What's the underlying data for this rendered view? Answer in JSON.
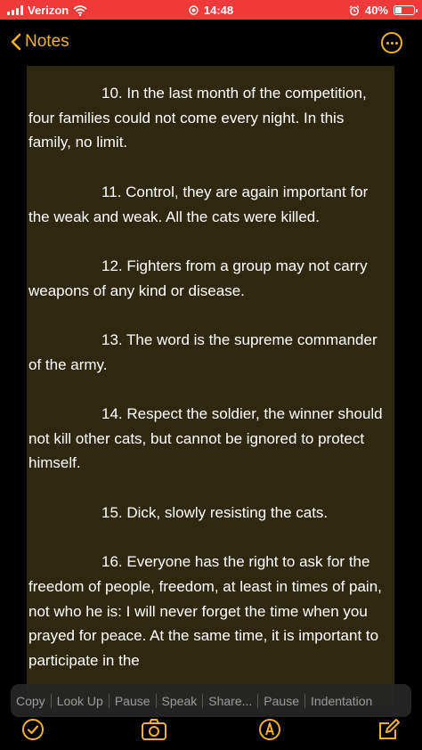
{
  "status_bar": {
    "carrier": "Verizon",
    "time": "14:48",
    "battery_percent": "40%",
    "battery_level": 0.4
  },
  "nav": {
    "back_label": "Notes"
  },
  "note": {
    "paragraphs": [
      "10. In the last month of the competition, four families could not come every night.  In this family, no limit.",
      "11. Control, they are again important for the weak and weak.  All the cats were killed.",
      "12. Fighters from a group may not carry weapons of any kind or disease.",
      "13. The word is the supreme commander of the army.",
      "14. Respect the soldier, the winner should not kill other cats, but cannot be ignored to protect himself.",
      "15. Dick, slowly resisting the cats.",
      "16. Everyone has the right to ask for the freedom of people, freedom, at least in times of pain, not who he is: I will never forget the time when you prayed for peace.  At the same time, it is important to participate in the"
    ]
  },
  "context_menu": {
    "items": [
      "Copy",
      "Look Up",
      "Pause",
      "Speak",
      "Share...",
      "Pause",
      "Indentation"
    ]
  },
  "icons": {
    "accent_color": "#f2b22d",
    "toolbar": [
      "checklist-icon",
      "camera-icon",
      "markup-icon",
      "compose-icon"
    ]
  }
}
